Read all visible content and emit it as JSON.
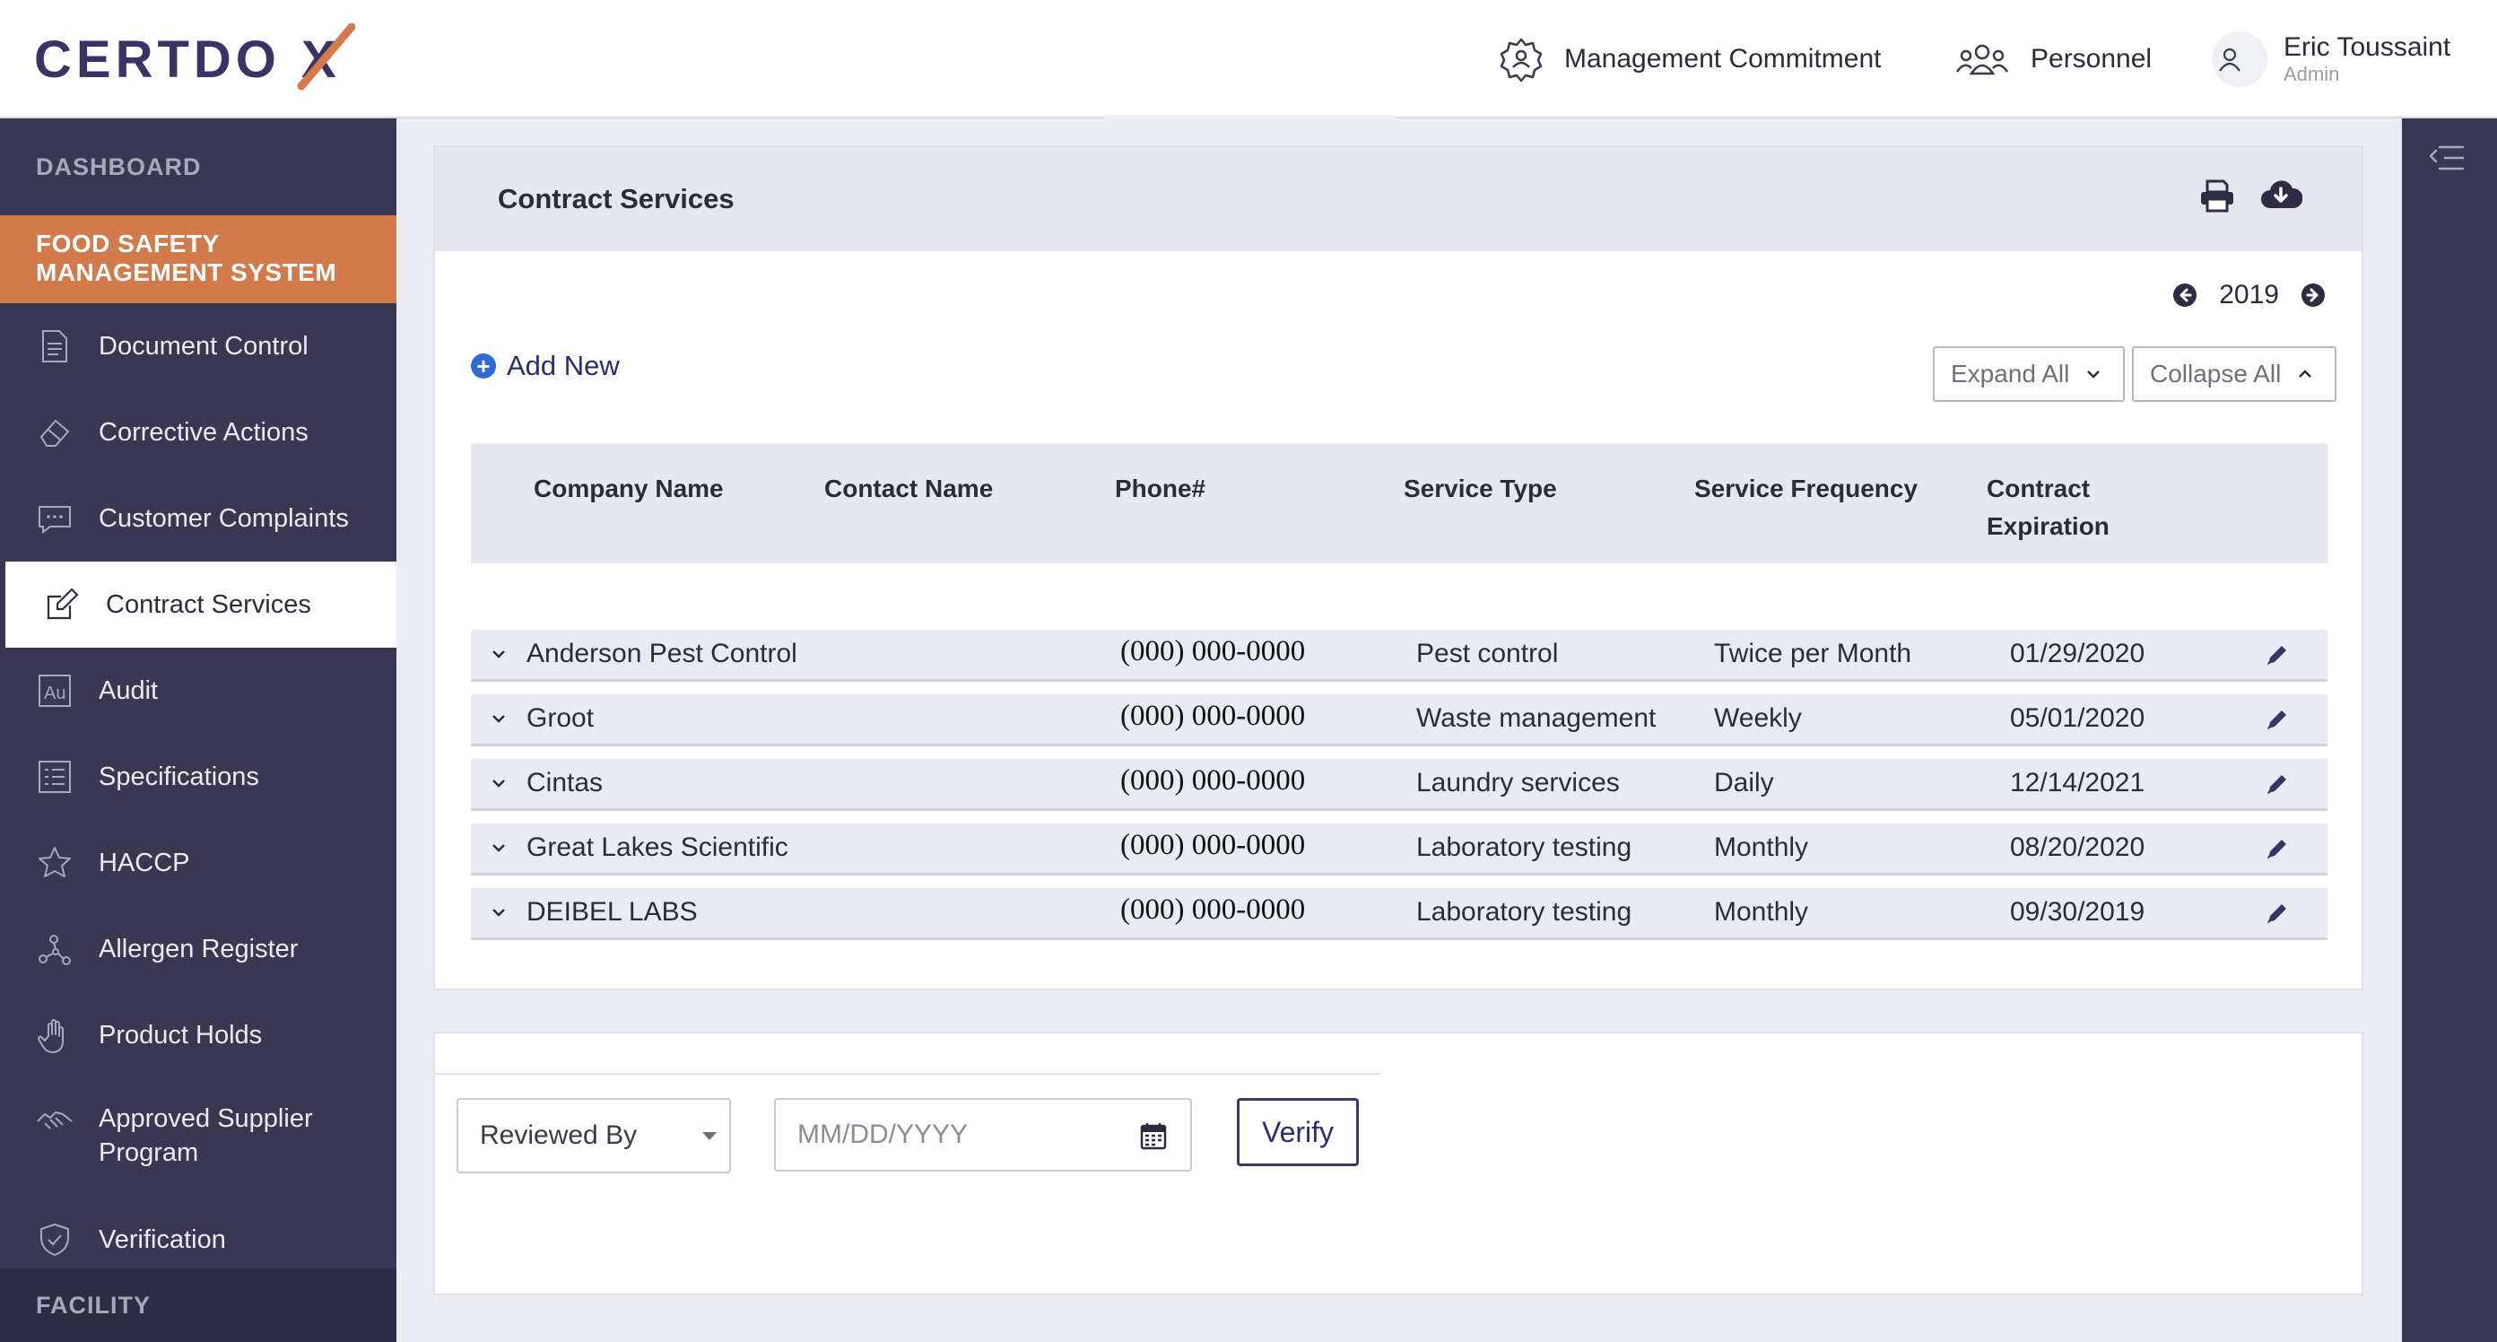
{
  "header": {
    "logo_text": "CERTDOX",
    "nav": [
      {
        "label": "Management Commitment",
        "icon": "gear-icon"
      },
      {
        "label": "Personnel",
        "icon": "users-icon"
      }
    ],
    "user": {
      "name": "Eric Toussaint",
      "role": "Admin"
    }
  },
  "sidebar": {
    "section_top": "DASHBOARD",
    "group_title": "FOOD SAFETY MANAGEMENT SYSTEM",
    "items": [
      {
        "label": "Document Control",
        "icon": "document-icon"
      },
      {
        "label": "Corrective Actions",
        "icon": "eraser-icon"
      },
      {
        "label": "Customer Complaints",
        "icon": "chat-icon"
      },
      {
        "label": "Contract Services",
        "icon": "edit-icon",
        "active": true
      },
      {
        "label": "Audit",
        "icon": "au-icon"
      },
      {
        "label": "Specifications",
        "icon": "list-icon"
      },
      {
        "label": "HACCP",
        "icon": "star-icon"
      },
      {
        "label": "Allergen Register",
        "icon": "molecule-icon"
      },
      {
        "label": "Product Holds",
        "icon": "hand-icon"
      },
      {
        "label": "Approved Supplier Program",
        "icon": "handshake-icon"
      },
      {
        "label": "Verification",
        "icon": "shield-check-icon"
      }
    ],
    "section_bottom": "FACILITY"
  },
  "main": {
    "title": "Contract Services",
    "year": "2019",
    "add_new_label": "Add New",
    "expand_label": "Expand All",
    "collapse_label": "Collapse All",
    "columns": [
      "Company Name",
      "Contact Name",
      "Phone#",
      "Service Type",
      "Service Frequency",
      "Contract Expiration"
    ],
    "rows": [
      {
        "company": "Anderson Pest Control",
        "contact": "",
        "phone": "(000) 000-0000",
        "service_type": "Pest control",
        "frequency": "Twice per Month",
        "expiration": "01/29/2020"
      },
      {
        "company": "Groot",
        "contact": "",
        "phone": "(000) 000-0000",
        "service_type": "Waste management",
        "frequency": "Weekly",
        "expiration": "05/01/2020"
      },
      {
        "company": "Cintas",
        "contact": "",
        "phone": "(000) 000-0000",
        "service_type": "Laundry services",
        "frequency": "Daily",
        "expiration": "12/14/2021"
      },
      {
        "company": "Great Lakes Scientific",
        "contact": "",
        "phone": "(000) 000-0000",
        "service_type": "Laboratory testing",
        "frequency": "Monthly",
        "expiration": "08/20/2020"
      },
      {
        "company": "DEIBEL LABS",
        "contact": "",
        "phone": "(000) 000-0000",
        "service_type": "Laboratory testing",
        "frequency": "Monthly",
        "expiration": "09/30/2019"
      }
    ]
  },
  "review": {
    "reviewed_by_label": "Reviewed By",
    "date_placeholder": "MM/DD/YYYY",
    "verify_label": "Verify"
  },
  "colors": {
    "sidebar_bg": "#393752",
    "accent_orange": "#d37a4a",
    "link_blue": "#2f6ad8"
  }
}
